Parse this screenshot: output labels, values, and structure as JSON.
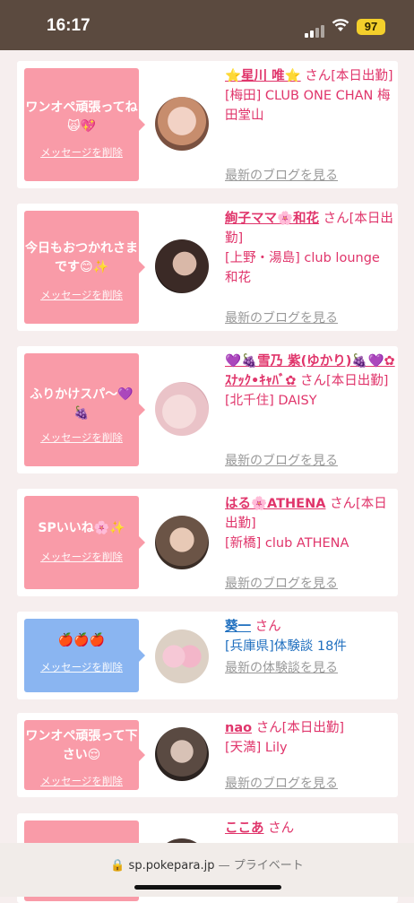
{
  "status": {
    "time": "16:17",
    "battery": "97"
  },
  "cards": [
    {
      "message": "ワンオペ頑張ってね🙀💖",
      "delete": "メッセージを削除",
      "name": "⭐星川 唯⭐",
      "san": "さん[本日出勤]",
      "shop": "[梅田] CLUB ONE CHAN 梅田堂山",
      "link": "最新のブログを見る"
    },
    {
      "message": "今日もおつかれさまです😊✨",
      "delete": "メッセージを削除",
      "name": "絢子ママ🌸和花",
      "san": "さん[本日出勤]",
      "shop": "[上野・湯島] club lounge 和花",
      "link": "最新のブログを見る"
    },
    {
      "message": "ふりかけスパ〜💜🍇",
      "delete": "メッセージを削除",
      "name": "💜🍇雪乃 紫(ゆかり)🍇💜✿ ｽﾅｯｸ•ｷｬﾊﾞ✿",
      "san": "さん[本日出勤]",
      "shop": "[北千住] DAISY",
      "link": "最新のブログを見る"
    },
    {
      "message": "SPいいね🌸✨",
      "delete": "メッセージを削除",
      "name": "はる🌸ATHENA",
      "san": "さん[本日出勤]",
      "shop": "[新橋] club ATHENA",
      "link": "最新のブログを見る"
    },
    {
      "message": "🍎🍎🍎",
      "delete": "メッセージを削除",
      "name": "葵一",
      "san": "さん",
      "shop": "[兵庫県]体験談 18件",
      "link": "最新の体験談を見る"
    },
    {
      "message": "ワンオペ頑張って下さい😌",
      "delete": "メッセージを削除",
      "name": "nao",
      "san": "さん[本日出勤]",
      "shop": "[天満] Lily",
      "link": "最新のブログを見る"
    },
    {
      "name": "ここあ",
      "san": "さん"
    }
  ],
  "browser": {
    "url": "sp.pokepara.jp",
    "private": "— プライベート"
  }
}
